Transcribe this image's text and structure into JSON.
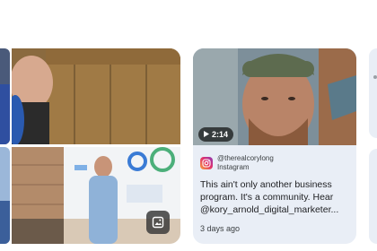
{
  "social_card": {
    "video_duration": "2:14",
    "handle": "@therealcorylong",
    "platform": "Instagram",
    "description": "This ain't only another business program. It's a community. Hear @kory_arnold_digital_marketer...",
    "timestamp": "3 days ago"
  },
  "icons": {
    "play": "play-icon",
    "instagram": "instagram-icon",
    "gallery": "image-gallery-icon"
  },
  "colors": {
    "card_background": "#e9eef6",
    "text_primary": "#202124",
    "text_secondary": "#3c4043"
  }
}
